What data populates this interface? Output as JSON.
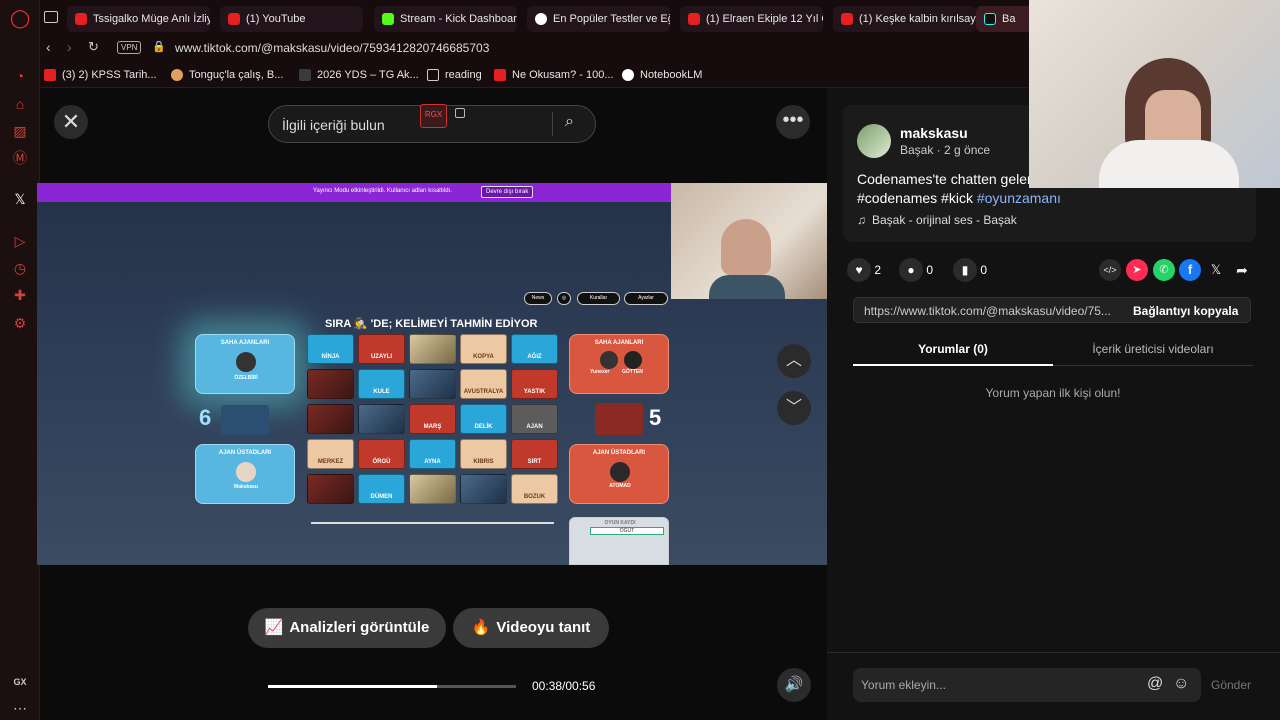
{
  "browser": {
    "tabs": [
      {
        "label": "Tssigalko Müge Anlı İzliy",
        "color": "#e62020"
      },
      {
        "label": "(1) YouTube",
        "color": "#e62020"
      },
      {
        "label": "Stream - Kick Dashboar",
        "color": "#53fc18"
      },
      {
        "label": "En Popüler Testler ve Eğ",
        "color": "#ffffff"
      },
      {
        "label": "(1) Elraen Ekiple 12 Yıl Ö",
        "color": "#e62020"
      },
      {
        "label": "(1) Keşke kalbin kırılsayc",
        "color": "#e62020"
      },
      {
        "label": "Ba",
        "color": "#25f4ee"
      }
    ],
    "vpn": "VPN",
    "url": "www.tiktok.com/@makskasu/video/7593412820746685703",
    "bookmarks": [
      {
        "label": "(3) 2) KPSS Tarih...",
        "color": "#e62020"
      },
      {
        "label": "Tonguç'la çalış, B...",
        "color": "#e0a060"
      },
      {
        "label": "2026 YDS – TG Ak...",
        "color": "#3a3a3a"
      },
      {
        "label": "reading",
        "color": "#888888"
      },
      {
        "label": "Ne Okusam? - 100...",
        "color": "#e62020"
      },
      {
        "label": "NotebookLM",
        "color": "#ffffff"
      }
    ],
    "sidebar_bottom_label": "GX"
  },
  "tiktok": {
    "search_placeholder": "İlgili içeriği bulun",
    "search_badge": "RGX",
    "buttons": {
      "analytics": "Analizleri görüntüle",
      "promote": "Videoyu tanıt"
    },
    "time": "00:38/00:56",
    "progress": 0.68
  },
  "game": {
    "banner_text": "Yayıncı Modu etkinleştirildi. Kullanıcı adları kısaltıldı.",
    "banner_button": "Devre dışı bırak",
    "turn_text": "SIRA 🕵 'DE; KELİMEYİ TAHMİN EDİYOR",
    "controls": [
      "News",
      "Kurallar",
      "Ayarlar"
    ],
    "blue_team": {
      "agents_label": "SAHA AJANLARI",
      "agent": "ÖZELBİRİ",
      "score": "6",
      "spymasters_label": "AJAN ÜSTADLARI",
      "spymaster": "Makskasu"
    },
    "red_team": {
      "agents_label": "SAHA AJANLARI",
      "agent1": "Yunexer",
      "agent2": "GÖTTEN",
      "score": "5",
      "spymasters_label": "AJAN ÜSTADLARI",
      "spymaster": "ATOMAD"
    },
    "log_label": "OYUN KAYDI",
    "log_entry": "ÖĞÜT",
    "cards": [
      [
        "NİNJA",
        "UZAYLI",
        "",
        "KOPYA",
        "AĞIZ"
      ],
      [
        "",
        "KULE",
        "",
        "AVUSTRALYA",
        "YASTIK"
      ],
      [
        "",
        "",
        "MARŞ",
        "DELİK",
        "AJAN"
      ],
      [
        "MERKEZ",
        "ÖRGÜ",
        "AYNA",
        "KIBRIS",
        "SIRT"
      ],
      [
        "",
        "DÜMEN",
        "",
        "",
        "BOZUK"
      ]
    ]
  },
  "post": {
    "username": "makskasu",
    "subtitle": "Başak · 2 g önce",
    "caption": "Codenames'te chatten geler",
    "tags_plain": "#codenames #kick ",
    "tag_link": "#oyunzamanı",
    "sound": "Başak - orijinal ses - Başak",
    "likes": "2",
    "comments": "0",
    "saves": "0",
    "link": "https://www.tiktok.com/@makskasu/video/75...",
    "copy_link": "Bağlantıyı kopyala",
    "tab_comments": "Yorumlar (0)",
    "tab_creator": "İçerik üreticisi videoları",
    "empty_comments": "Yorum yapan ilk kişi olun!",
    "comment_placeholder": "Yorum ekleyin...",
    "send": "Gönder"
  }
}
